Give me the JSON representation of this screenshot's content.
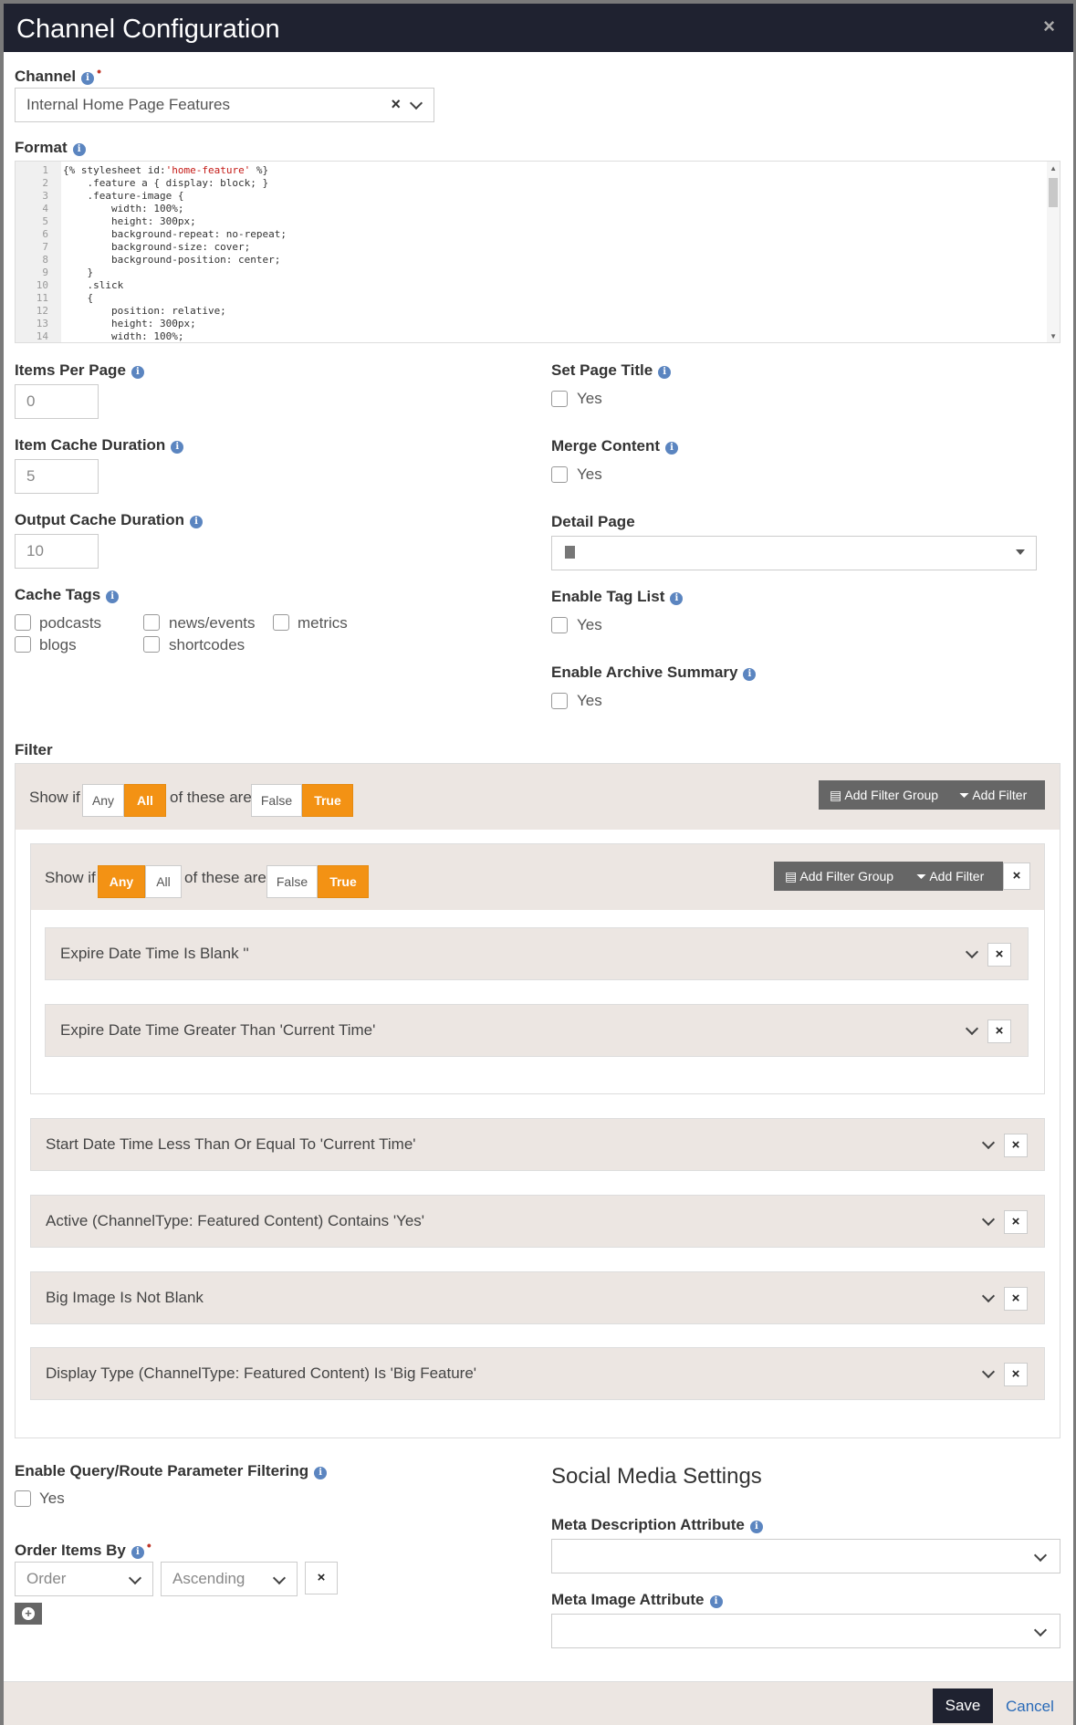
{
  "header": {
    "title": "Channel Configuration",
    "close": "×"
  },
  "channel": {
    "label": "Channel",
    "value": "Internal Home Page Features"
  },
  "format": {
    "label": "Format",
    "lines": [
      {
        "n": "1",
        "t": "{% stylesheet id:",
        "s": "'home-feature'",
        "e": " %}"
      },
      {
        "n": "2",
        "t": "    .feature a { display: block; }"
      },
      {
        "n": "3",
        "t": "    .feature-image {"
      },
      {
        "n": "4",
        "t": "        width: 100%;"
      },
      {
        "n": "5",
        "t": "        height: 300px;"
      },
      {
        "n": "6",
        "t": "        background-repeat: no-repeat;"
      },
      {
        "n": "7",
        "t": "        background-size: cover;"
      },
      {
        "n": "8",
        "t": "        background-position: center;"
      },
      {
        "n": "9",
        "t": "    }"
      },
      {
        "n": "10",
        "t": "    .slick"
      },
      {
        "n": "11",
        "t": "    {"
      },
      {
        "n": "12",
        "t": "        position: relative;"
      },
      {
        "n": "13",
        "t": "        height: 300px;"
      },
      {
        "n": "14",
        "t": "        width: 100%;"
      }
    ]
  },
  "left": {
    "items_per_page": {
      "label": "Items Per Page",
      "value": "0"
    },
    "item_cache": {
      "label": "Item Cache Duration",
      "value": "5"
    },
    "output_cache": {
      "label": "Output Cache Duration",
      "value": "10"
    },
    "cache_tags": {
      "label": "Cache Tags",
      "tags": [
        "podcasts",
        "news/events",
        "metrics",
        "blogs",
        "shortcodes"
      ]
    }
  },
  "right": {
    "set_page_title": {
      "label": "Set Page Title",
      "opt": "Yes"
    },
    "merge_content": {
      "label": "Merge Content",
      "opt": "Yes"
    },
    "detail_page": {
      "label": "Detail Page"
    },
    "enable_tag_list": {
      "label": "Enable Tag List",
      "opt": "Yes"
    },
    "archive_summary": {
      "label": "Enable Archive Summary",
      "opt": "Yes"
    }
  },
  "filter": {
    "label": "Filter",
    "show_if": "Show if",
    "of_these": "of these are",
    "any": "Any",
    "all": "All",
    "false": "False",
    "true": "True",
    "add_group": "Add Filter Group",
    "add_filter": "Add Filter",
    "inner_rows": [
      "Expire Date Time Is Blank ''",
      "Expire Date Time Greater Than 'Current Time'"
    ],
    "rows": [
      "Start Date Time Less Than Or Equal To 'Current Time'",
      "Active (ChannelType: Featured Content) Contains 'Yes'",
      "Big Image Is Not Blank",
      "Display Type (ChannelType: Featured Content) Is 'Big Feature'"
    ]
  },
  "query_filter": {
    "label": "Enable Query/Route Parameter Filtering",
    "opt": "Yes"
  },
  "order": {
    "label": "Order Items By",
    "field": "Order",
    "direction": "Ascending"
  },
  "social": {
    "title": "Social Media Settings",
    "meta_desc": "Meta Description Attribute",
    "meta_image": "Meta Image Attribute"
  },
  "footer": {
    "save": "Save",
    "cancel": "Cancel"
  }
}
